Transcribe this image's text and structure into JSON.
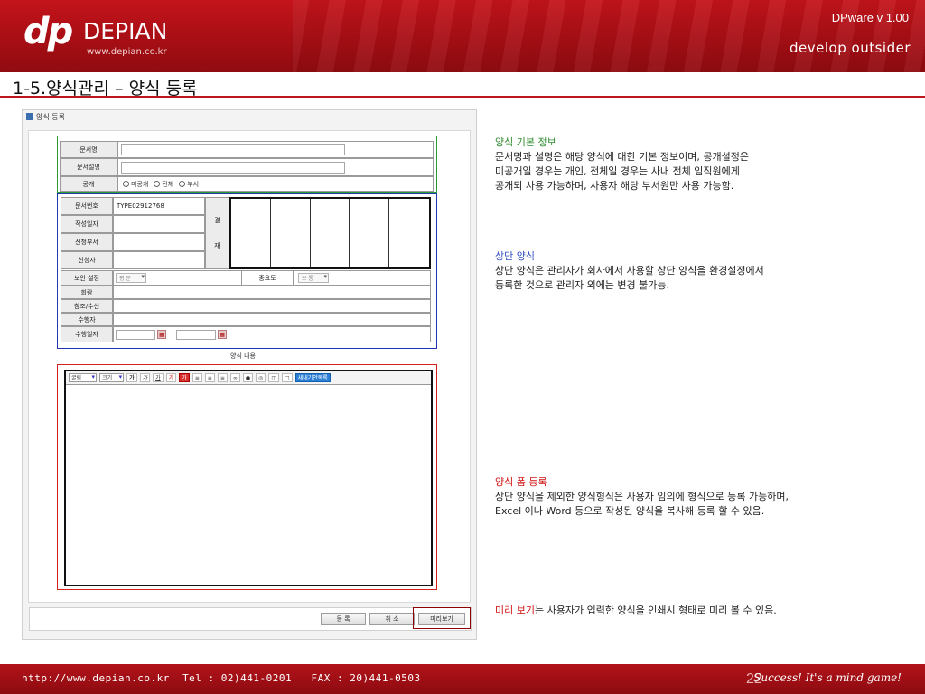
{
  "header": {
    "logo_mark": "dp",
    "logo_name": "DEPIAN",
    "logo_url": "www.depian.co.kr",
    "version": "DPware v 1.00",
    "slogan": "develop outsider"
  },
  "slide_title": "1-5.양식관리 – 양식 등록",
  "screenshot": {
    "window_title": "양식 등록",
    "basic": {
      "doc_name_label": "문서명",
      "doc_desc_label": "문서설명",
      "public_label": "공개",
      "public_options": [
        "미공개",
        "전체",
        "부서"
      ]
    },
    "top_form": {
      "doc_no_label": "문서번호",
      "doc_no_value": "TYPE02912768",
      "date_label": "작성일자",
      "dept_label": "신청부서",
      "applicant_label": "신청자",
      "approval_label_1": "결",
      "approval_label_2": "재",
      "security_label": "보안 설정",
      "security_value": "평 문",
      "importance_label": "중요도",
      "importance_value": "보 통",
      "circulate_label": "회람",
      "reference_label": "참조/수신",
      "executor_label": "수행자",
      "exec_date_label": "수행일자",
      "range_sep": "~"
    },
    "content_label": "양식 내용",
    "editor": {
      "font_select": "굴림",
      "size_select": "크기",
      "buttons": [
        "가",
        "가",
        "가",
        "가",
        "가"
      ],
      "special_button": "새내기안목록"
    },
    "buttons": {
      "register": "등 록",
      "cancel": "취 소",
      "preview": "미리보기"
    }
  },
  "descriptions": {
    "basic_title": "양식 기본 정보",
    "basic_lines": [
      "문서명과 설명은 해당 양식에 대한 기본 정보이며, 공개설정은",
      "미공개일 경우는 개인, 전체일 경우는 사내 전체 임직원에게",
      "공개되 사용 가능하며, 사용자 해당 부서원만 사용 가능함."
    ],
    "top_title": "상단 양식",
    "top_lines": [
      "상단 양식은 관리자가 회사에서 사용할 상단 양식을 환경설정에서",
      "등록한 것으로 관리자 외에는 변경 불가능."
    ],
    "register_title": "양식 폼 등록",
    "register_lines": [
      "상단 양식을 제외한 양식형식은 사용자 임의에 형식으로 등록 가능하며,",
      "Excel 이나 Word 등으로 작성된 양식을 복사해 등록 할 수 있음."
    ],
    "preview_title": "미리 보기",
    "preview_rest": "는 사용자가 입력한 양식을 인쇄시 형태로 미리 볼 수 있음."
  },
  "colors": {
    "basic_title": "#2c8a2c",
    "top_title": "#2f4cc0",
    "register_title": "#d01010",
    "preview_title": "#d01010"
  },
  "footer": {
    "contact": "http://www.depian.co.kr  Tel : 02)441-0201   FAX : 20)441-0503",
    "page_number": "22",
    "slogan": "Success! It's a mind game!"
  }
}
